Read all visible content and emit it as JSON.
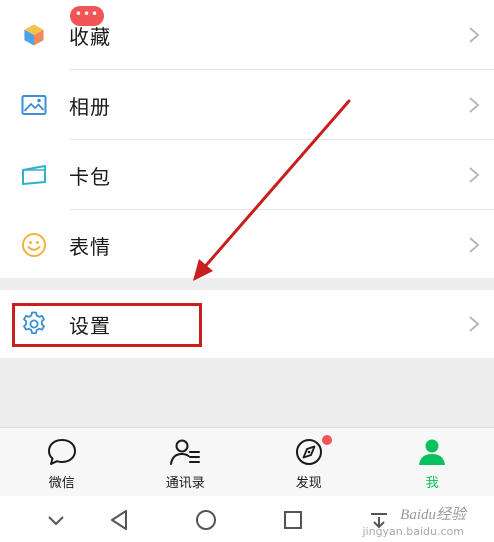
{
  "menu": {
    "items": [
      {
        "label": "收藏",
        "icon": "favorites-cube-icon"
      },
      {
        "label": "相册",
        "icon": "album-icon"
      },
      {
        "label": "卡包",
        "icon": "card-wallet-icon"
      },
      {
        "label": "表情",
        "icon": "sticker-smile-icon"
      }
    ],
    "settings": {
      "label": "设置",
      "icon": "gear-icon"
    }
  },
  "tabbar": {
    "tabs": [
      {
        "label": "微信",
        "icon": "chat-bubble-icon",
        "badge": "•••"
      },
      {
        "label": "通讯录",
        "icon": "contacts-icon"
      },
      {
        "label": "发现",
        "icon": "compass-icon",
        "dot": true
      },
      {
        "label": "我",
        "icon": "person-icon",
        "active": true
      }
    ]
  },
  "navbar": {
    "buttons": [
      "collapse-chevron-icon",
      "back-triangle-icon",
      "home-circle-icon",
      "recents-square-icon",
      "notification-pull-icon"
    ]
  },
  "watermark": {
    "text": "Baidu经验",
    "sub": "jingyan.baidu.com"
  },
  "colors": {
    "accent_green": "#07c160",
    "badge_red": "#f25555",
    "annotation_red": "#c81e1e",
    "icon_blue": "#3a8fd6"
  }
}
